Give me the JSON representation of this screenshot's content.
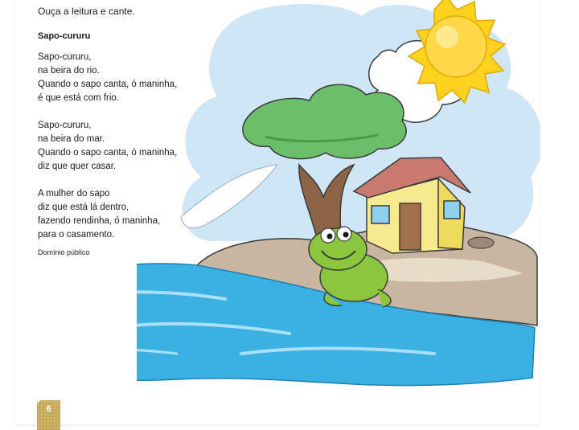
{
  "instruction": "Ouça a leitura e cante.",
  "poem": {
    "title": "Sapo-cururu",
    "stanzas": [
      [
        "Sapo-cururu,",
        "na beira do rio.",
        "Quando o sapo canta, ó maninha,",
        "é que está com frio."
      ],
      [
        "Sapo-cururu,",
        "na beira do mar.",
        "Quando o sapo canta, ó maninha,",
        "diz que quer casar."
      ],
      [
        "A mulher do sapo",
        "diz que está lá dentro,",
        "fazendo rendinha, ó maninha,",
        "para o casamento."
      ]
    ],
    "source": "Domínio público"
  },
  "page_number": "6",
  "colors": {
    "sky": "#cfe6f7",
    "sun": "#ffd21f",
    "water": "#3bb0e3",
    "island": "#c8b6a0",
    "frog": "#8cc63e",
    "tree_foliage": "#6cbf6a",
    "house_wall": "#f7ea8e",
    "roof": "#c97a6e",
    "badge": "#c5a85a"
  },
  "illustration": {
    "icons": [
      "sun-icon",
      "cloud-icon",
      "tree-icon",
      "house-icon",
      "frog-icon",
      "water-icon"
    ]
  }
}
